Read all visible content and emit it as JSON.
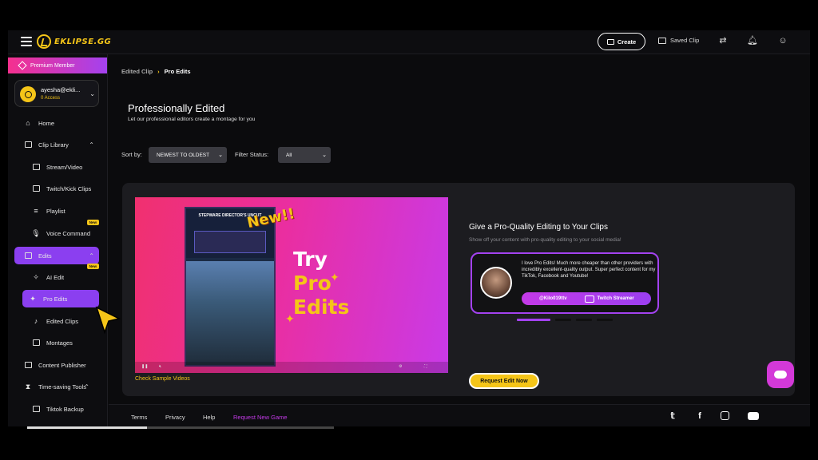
{
  "topbar": {
    "brand": "EKLIPSE.GG",
    "create_label": "Create",
    "saved_clip_label": "Saved Clip",
    "icons": [
      "menu-icon",
      "swap-icon",
      "bell-icon",
      "user-icon"
    ]
  },
  "sidebar": {
    "premium_label": "Premium Member",
    "user": {
      "email": "ayesha@ekli...",
      "access": "0 Access"
    },
    "items": [
      {
        "label": "Home",
        "icon": "home-icon"
      },
      {
        "label": "Clip Library",
        "icon": "film-icon"
      },
      {
        "label": "Stream/Video",
        "icon": "video-icon"
      },
      {
        "label": "Twitch/Kick Clips",
        "icon": "twitch-icon"
      },
      {
        "label": "Playlist",
        "icon": "playlist-icon"
      },
      {
        "label": "Voice Command",
        "icon": "voice-icon",
        "badge": "New"
      },
      {
        "label": "Edits",
        "icon": "edits-icon"
      },
      {
        "label": "AI Edit",
        "icon": "wand-icon",
        "badge": "New"
      },
      {
        "label": "Pro Edits",
        "icon": "sparkle-icon"
      },
      {
        "label": "Edited Clips",
        "icon": "music-icon"
      },
      {
        "label": "Montages",
        "icon": "montage-icon"
      },
      {
        "label": "Content Publisher",
        "icon": "calendar-icon"
      },
      {
        "label": "Time-saving Tools",
        "icon": "hourglass-icon"
      },
      {
        "label": "Tiktok Backup",
        "icon": "backup-icon"
      }
    ]
  },
  "breadcrumb": {
    "parent": "Edited Clip",
    "current": "Pro Edits"
  },
  "page": {
    "title": "Professionally Edited",
    "subtitle": "Let our professional editors create a montage for you"
  },
  "filters": {
    "sort_label": "Sort by:",
    "sort_value": "NEWEST TO OLDEST",
    "status_label": "Filter Status:",
    "status_value": "All"
  },
  "promo": {
    "phone_title": "STEPWARE DIRECTOR'S UNCUT",
    "new_text": "New!!",
    "try_line1": "Try",
    "try_line2": "Pro",
    "try_line3": "Edits",
    "check_link": "Check Sample Videos"
  },
  "offer": {
    "title": "Give a Pro-Quality Editing to Your Clips",
    "subtitle": "Show off your content with pro-quality editing to your social media!",
    "testimonial_text": "I love Pro Edits! Much more cheaper than other providers with incredibly excellent-quality output. Super perfect content for my TikTok, Facebook and Youtube!",
    "handle": "@Kilo019ttv",
    "role": "Twitch Streamer",
    "request_label": "Request Edit Now"
  },
  "footer": {
    "links": [
      "Terms",
      "Privacy",
      "Help"
    ],
    "highlight_link": "Request New Game",
    "social": [
      "twitter-icon",
      "facebook-icon",
      "instagram-icon",
      "youtube-icon",
      "tiktok-icon"
    ]
  },
  "colors": {
    "accent_purple": "#8b3ff0",
    "accent_yellow": "#f5c518",
    "accent_pink": "#f0306f"
  }
}
